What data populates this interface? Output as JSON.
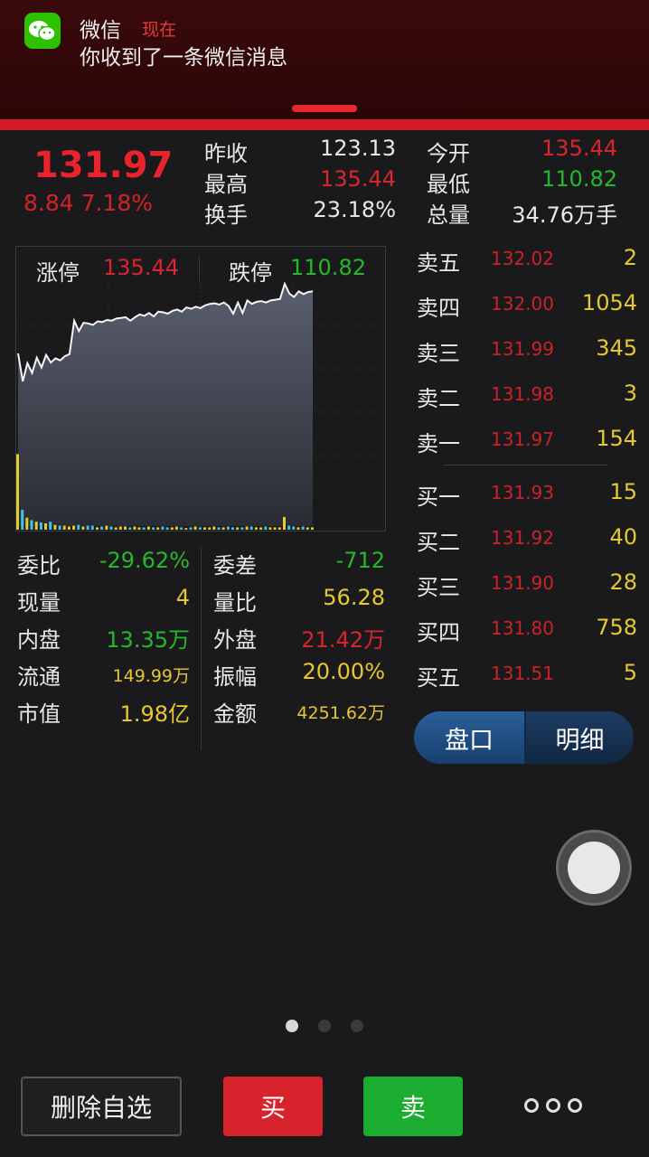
{
  "notification": {
    "app": "微信",
    "time": "现在",
    "message": "你收到了一条微信消息",
    "icon": "wechat-icon",
    "accent": "#d21d26"
  },
  "header": {
    "price": "131.97",
    "change": "8.84  7.18%",
    "prev_close_label": "昨收",
    "prev_close": "123.13",
    "open_label": "今开",
    "open": "135.44",
    "high_label": "最高",
    "high": "135.44",
    "low_label": "最低",
    "low": "110.82",
    "turnover_label": "换手",
    "turnover": "23.18%",
    "volume_label": "总量",
    "volume": "34.76万手"
  },
  "chart": {
    "limit_up_label": "涨停",
    "limit_up": "135.44",
    "limit_down_label": "跌停",
    "limit_down": "110.82"
  },
  "chart_data": {
    "type": "line",
    "ylim": [
      110.82,
      135.44
    ],
    "x": [
      0,
      1,
      2,
      3,
      4,
      5,
      6,
      7,
      8,
      9,
      10,
      11,
      12,
      13,
      14,
      15,
      16,
      17,
      18,
      19,
      20,
      21,
      22,
      23,
      24,
      25,
      26,
      27,
      28,
      29,
      30,
      31,
      32,
      33,
      34,
      35,
      36,
      37,
      38,
      39,
      40,
      41,
      42,
      43,
      44,
      45,
      46,
      47,
      48,
      49,
      50,
      51,
      52,
      53,
      54,
      55,
      56,
      57,
      58,
      59,
      60,
      61,
      62,
      63
    ],
    "series": [
      {
        "values": [
          125.2,
          121.2,
          123.8,
          122.4,
          124.6,
          123.2,
          125.0,
          123.9,
          124.5,
          124.2,
          124.8,
          125.1,
          129.9,
          128.4,
          129.6,
          129.5,
          129.3,
          129.8,
          129.7,
          130.0,
          129.9,
          130.2,
          130.3,
          130.4,
          129.9,
          130.4,
          130.8,
          130.6,
          131.0,
          130.5,
          131.2,
          131.1,
          130.9,
          131.3,
          131.5,
          131.2,
          131.8,
          131.6,
          131.9,
          131.7,
          132.1,
          132.3,
          132.4,
          132.2,
          132.5,
          132.0,
          130.9,
          132.5,
          131.0,
          132.8,
          132.3,
          132.6,
          132.7,
          132.5,
          132.8,
          132.9,
          133.0,
          135.2,
          133.8,
          133.3,
          134.1,
          133.7,
          134.0,
          134.1
        ]
      }
    ],
    "volume": [
      0.95,
      0.25,
      0.15,
      0.12,
      0.1,
      0.09,
      0.08,
      0.1,
      0.06,
      0.05,
      0.05,
      0.04,
      0.05,
      0.06,
      0.04,
      0.05,
      0.05,
      0.03,
      0.04,
      0.05,
      0.04,
      0.03,
      0.04,
      0.04,
      0.03,
      0.04,
      0.03,
      0.03,
      0.04,
      0.03,
      0.03,
      0.04,
      0.03,
      0.03,
      0.04,
      0.03,
      0.02,
      0.03,
      0.04,
      0.03,
      0.03,
      0.03,
      0.04,
      0.03,
      0.03,
      0.04,
      0.03,
      0.03,
      0.03,
      0.04,
      0.04,
      0.03,
      0.03,
      0.04,
      0.03,
      0.03,
      0.03,
      0.16,
      0.05,
      0.04,
      0.03,
      0.04,
      0.03,
      0.03
    ],
    "grid": true
  },
  "stats": [
    {
      "label": "委比",
      "value": "-29.62%",
      "color": "green"
    },
    {
      "label": "委差",
      "value": "-712",
      "color": "green"
    },
    {
      "label": "现量",
      "value": "4",
      "color": "yellow"
    },
    {
      "label": "量比",
      "value": "56.28",
      "color": "yellow"
    },
    {
      "label": "内盘",
      "value": "13.35万",
      "color": "green"
    },
    {
      "label": "外盘",
      "value": "21.42万",
      "color": "red"
    },
    {
      "label": "流通",
      "value": "149.99万",
      "color": "yellow"
    },
    {
      "label": "振幅",
      "value": "20.00%",
      "color": "yellow"
    },
    {
      "label": "市值",
      "value": "1.98亿",
      "color": "yellow"
    },
    {
      "label": "金额",
      "value": "4251.62万",
      "color": "yellow"
    }
  ],
  "order_book": {
    "asks": [
      {
        "label": "卖五",
        "price": "132.02",
        "vol": "2"
      },
      {
        "label": "卖四",
        "price": "132.00",
        "vol": "1054"
      },
      {
        "label": "卖三",
        "price": "131.99",
        "vol": "345"
      },
      {
        "label": "卖二",
        "price": "131.98",
        "vol": "3"
      },
      {
        "label": "卖一",
        "price": "131.97",
        "vol": "154"
      }
    ],
    "bids": [
      {
        "label": "买一",
        "price": "131.93",
        "vol": "15"
      },
      {
        "label": "买二",
        "price": "131.92",
        "vol": "40"
      },
      {
        "label": "买三",
        "price": "131.90",
        "vol": "28"
      },
      {
        "label": "买四",
        "price": "131.80",
        "vol": "758"
      },
      {
        "label": "买五",
        "price": "131.51",
        "vol": "5"
      }
    ]
  },
  "tabs": {
    "quote": "盘口",
    "detail": "明细"
  },
  "bottom": {
    "delete": "删除自选",
    "buy": "买",
    "sell": "卖",
    "more_icon": "more-dots-icon"
  }
}
